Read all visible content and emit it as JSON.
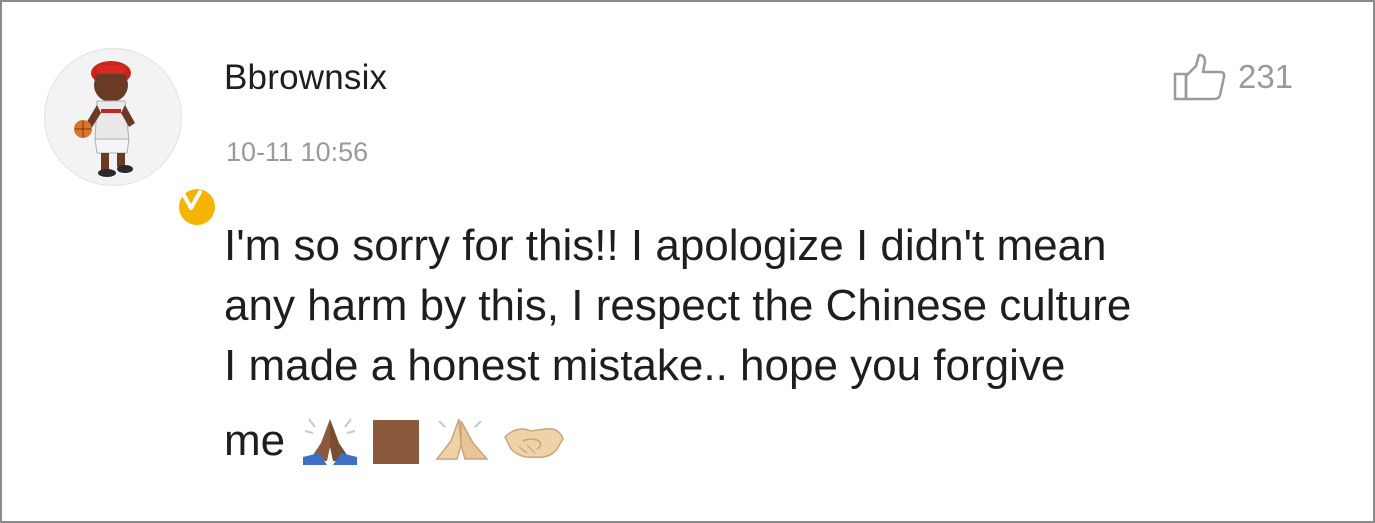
{
  "comment": {
    "username": "Bbrownsix",
    "timestamp": "10-11 10:56",
    "likes": "231",
    "text_lines": [
      "I'm so sorry for this!! I apologize I didn't mean",
      "any harm by this, I respect the Chinese culture",
      "I made a honest mistake.. hope you forgive",
      "me"
    ],
    "emojis": [
      "folded-hands-dark-skin",
      "brown-square",
      "folded-hands-light-skin",
      "handshake-light-skin"
    ]
  },
  "colors": {
    "text": "#1e1e1e",
    "muted": "#9a9a9a",
    "verified": "#f4b400",
    "border": "#8a8a8a"
  },
  "icons": {
    "like": "thumbs-up-icon",
    "verified": "verified-v-icon"
  }
}
